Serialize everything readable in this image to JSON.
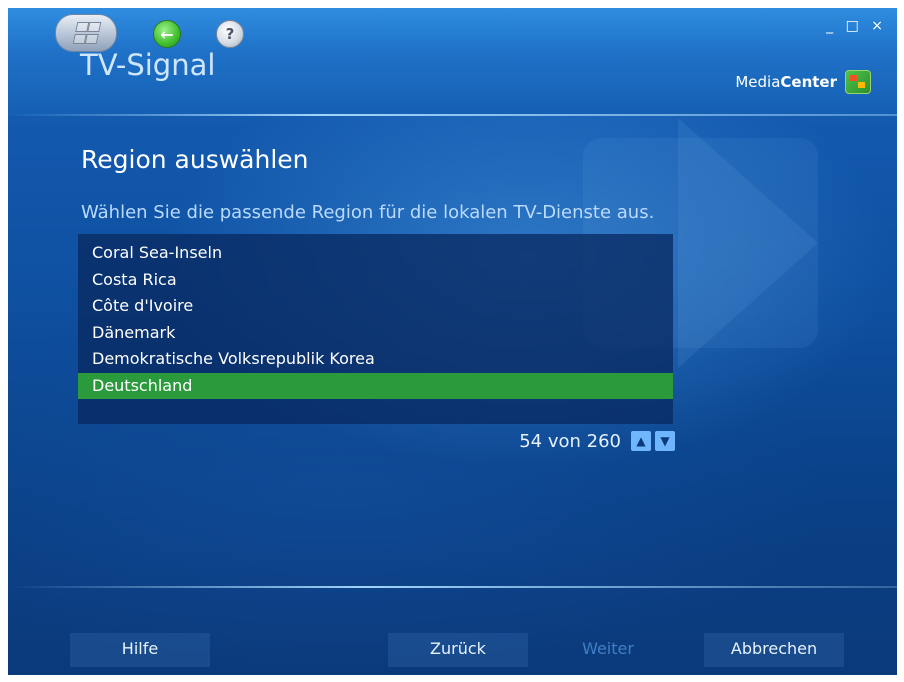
{
  "window": {
    "title": "TV-Signal",
    "controls": "_ □ ×",
    "brand": {
      "part1": "Media",
      "part2": "Center"
    }
  },
  "nav": {
    "back_icon": "back-arrow-icon",
    "help_icon": "help-question-icon",
    "start_icon": "windows-start-icon"
  },
  "page": {
    "heading": "Region auswählen",
    "instruction": "Wählen Sie die passende Region für die lokalen TV-Dienste aus."
  },
  "region_list": {
    "items": [
      "Coral Sea-Inseln",
      "Costa Rica",
      "Côte d'Ivoire",
      "Dänemark",
      "Demokratische Volksrepublik Korea",
      "Deutschland"
    ],
    "selected": "Deutschland",
    "position_text": "54 von 260",
    "up_arrow": "▲",
    "down_arrow": "▼"
  },
  "buttons": {
    "help": "Hilfe",
    "back": "Zurück",
    "next": "Weiter",
    "cancel": "Abbrechen"
  },
  "colors": {
    "background": "#0e4f9f",
    "selection": "#2a9a3c",
    "accent_text": "#b9dbff"
  }
}
